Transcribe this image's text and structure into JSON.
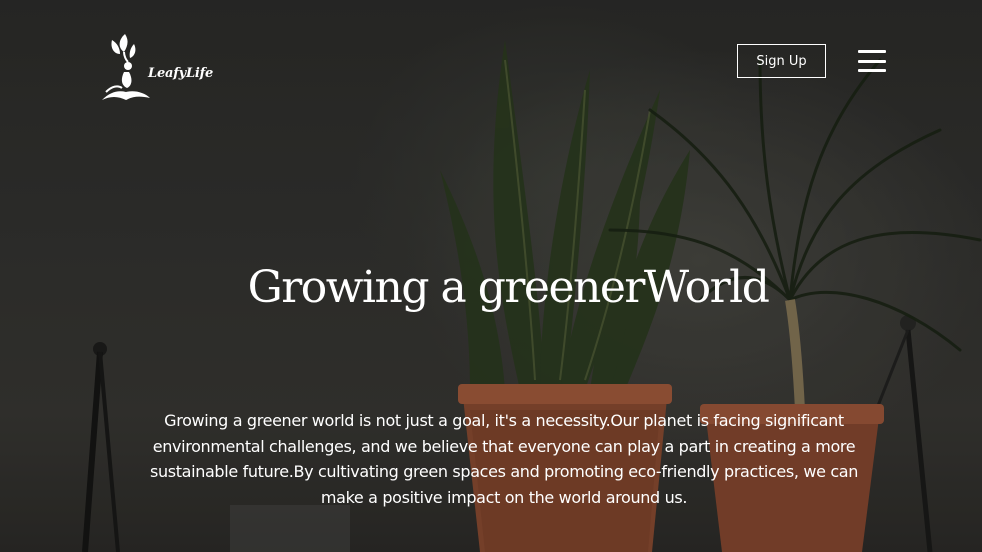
{
  "brand": {
    "name": "LeafyLife",
    "logo_icon": "person-with-leaves-icon"
  },
  "header": {
    "signup_label": "Sign Up",
    "menu_icon": "hamburger-menu-icon"
  },
  "hero": {
    "title": "Growing a greenerWorld",
    "description": "Growing a greener world is not just a goal, it's a necessity.Our planet is facing significant environmental challenges, and we believe that everyone can play a part in creating a more sustainable future.By cultivating green spaces and promoting eco-friendly practices, we can make a positive impact on the world around us.",
    "background": "potted-plants-photo"
  },
  "colors": {
    "text": "#ffffff",
    "background": "#2e2e2c",
    "pot": "#a0583a"
  }
}
